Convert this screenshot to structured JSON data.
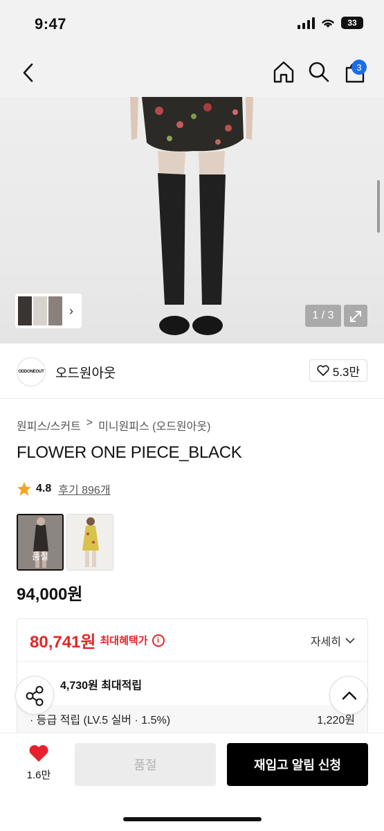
{
  "status": {
    "time": "9:47",
    "battery": "33"
  },
  "header": {
    "cart_badge": "3"
  },
  "gallery": {
    "pager": "1 / 3"
  },
  "brand": {
    "logo_text": "ODDONEOUT",
    "name": "오드원아웃",
    "likes": "5.3만"
  },
  "breadcrumb": {
    "category": "원피스/스커트",
    "separator": ">",
    "subcategory": "미니원피스 (오드원아웃)"
  },
  "product": {
    "title": "FLOWER ONE PIECE_BLACK",
    "rating": "4.8",
    "reviews": "후기 896개",
    "options": [
      {
        "label": "품절"
      }
    ],
    "price": "94,000원"
  },
  "benefit": {
    "max_price": "80,741원",
    "max_label": "최대혜택가",
    "detail": "자세히",
    "points": "4,730원 최대적립",
    "grade_label": "· 등급 적립 (LV.5 실버 · 1.5%)",
    "grade_value": "1,220원"
  },
  "bottom": {
    "like_count": "1.6만",
    "soldout": "품절",
    "restock": "재입고 알림 신청"
  },
  "colors": {
    "accent_red": "#e32626",
    "badge_blue": "#1d6ce8"
  }
}
